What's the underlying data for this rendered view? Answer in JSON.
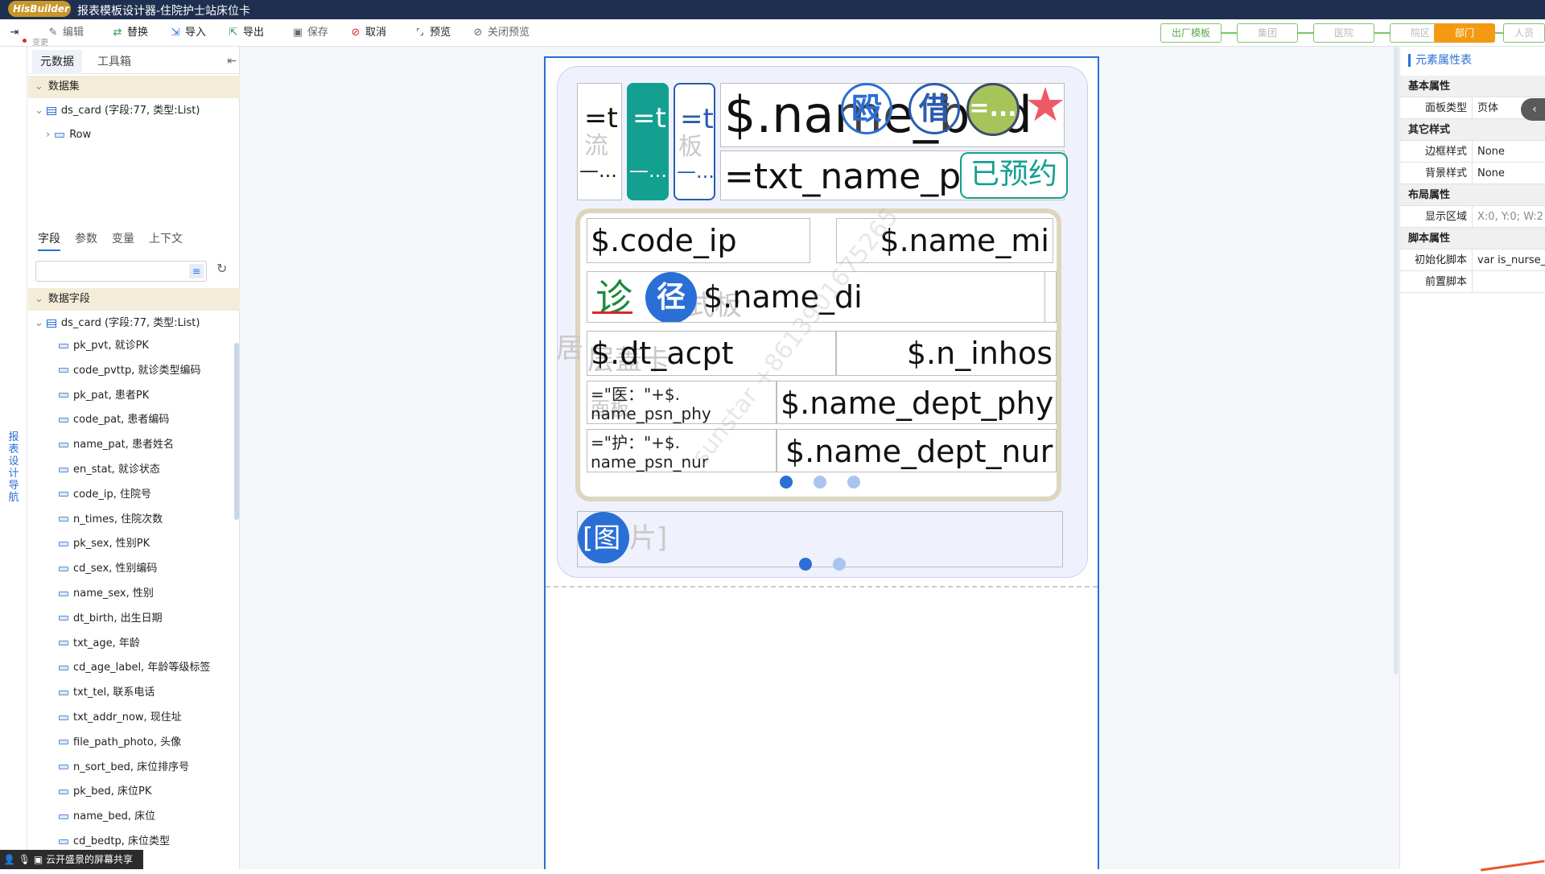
{
  "window": {
    "logo": "HisBuilder",
    "title": "报表模板设计器-住院护士站床位卡"
  },
  "toolbar": {
    "items": [
      {
        "label": "编辑",
        "icon": "pencil-icon"
      },
      {
        "label": "替换",
        "icon": "replace-icon"
      },
      {
        "label": "导入",
        "icon": "import-icon"
      },
      {
        "label": "导出",
        "icon": "export-icon"
      },
      {
        "label": "保存",
        "icon": "save-icon"
      },
      {
        "label": "取消",
        "icon": "cancel-icon"
      },
      {
        "label": "预览",
        "icon": "preview-icon"
      },
      {
        "label": "关闭预览",
        "icon": "close-preview-icon"
      }
    ],
    "sub_label": "变更"
  },
  "workflow": {
    "steps": [
      "出厂模板",
      "集团",
      "医院",
      "院区",
      "部门",
      "人员"
    ],
    "active": "部门"
  },
  "left_nav": {
    "label": "报表设计导航"
  },
  "left_panel": {
    "tabs": [
      "元数据",
      "工具箱"
    ],
    "dataset_header": "数据集",
    "dataset_node": "ds_card (字段:77, 类型:List)",
    "dataset_child": "Row",
    "sub_tabs": [
      "字段",
      "参数",
      "变量",
      "上下文"
    ],
    "search_placeholder": "",
    "fields_header": "数据字段",
    "fields_node": "ds_card (字段:77, 类型:List)",
    "fields": [
      "pk_pvt, 就诊PK",
      "code_pvttp, 就诊类型编码",
      "pk_pat, 患者PK",
      "code_pat, 患者编码",
      "name_pat, 患者姓名",
      "en_stat, 就诊状态",
      "code_ip, 住院号",
      "n_times, 住院次数",
      "pk_sex, 性别PK",
      "cd_sex, 性别编码",
      "name_sex, 性别",
      "dt_birth, 出生日期",
      "txt_age, 年龄",
      "cd_age_label, 年龄等级标签",
      "txt_tel, 联系电话",
      "txt_addr_now, 现住址",
      "file_path_photo, 头像",
      "n_sort_bed, 床位排序号",
      "pk_bed, 床位PK",
      "name_bed, 床位",
      "cd_bedtp, 床位类型"
    ]
  },
  "card": {
    "top_cells": [
      {
        "text": "=t",
        "ghost": "流",
        "sub": "—..."
      },
      {
        "text": "=t",
        "ghost": "",
        "sub": "—..."
      },
      {
        "text": "=t",
        "ghost": "板",
        "sub": "—..."
      }
    ],
    "name_bed": "$.name_bed",
    "badge_a": "殴",
    "badge_b": "借",
    "badge_c": "=...",
    "txt_name": "=txt_name_p",
    "reserved_badge": "已预约",
    "code_ip": "$.code_ip",
    "name_mi": "$.name_mi",
    "diag_icon_label": "诊",
    "path_badge": "径",
    "name_di": "$.name_di",
    "ghost_mid": "式板",
    "ghost_side": "居",
    "ghost_row3": "层蓋卡",
    "dt_acpt": "$.dt_acpt",
    "n_inhos": "$.n_inhos",
    "psn_phy_label": "=\"医：\"+$.",
    "psn_phy_field": "name_psn_phy",
    "dept_phy": "$.name_dept_phy",
    "psn_nur_label": "=\"护：\"+$.",
    "psn_nur_field": "name_psn_nur",
    "dept_nur": "$.name_dept_nur",
    "ghost_small": "面板",
    "image_label": "[图",
    "image_ghost": "片]",
    "watermark": "sunstar +8613901675265"
  },
  "right_panel": {
    "title": "元素属性表",
    "sections": [
      {
        "name": "基本属性",
        "rows": [
          {
            "key": "面板类型",
            "value": "页体"
          }
        ]
      },
      {
        "name": "其它样式",
        "rows": [
          {
            "key": "边框样式",
            "value": "None"
          },
          {
            "key": "背景样式",
            "value": "None"
          }
        ]
      },
      {
        "name": "布局属性",
        "rows": [
          {
            "key": "显示区域",
            "value": "X:0, Y:0; W:2"
          }
        ]
      },
      {
        "name": "脚本属性",
        "rows": [
          {
            "key": "初始化脚本",
            "value": "var is_nurse_"
          },
          {
            "key": "前置脚本",
            "value": ""
          }
        ]
      }
    ]
  },
  "share_bar": {
    "label": "云开盛景的屏幕共享"
  },
  "colors": {
    "title_bar": "#1f2f4f",
    "accent": "#2a6fd6",
    "teal": "#13a090",
    "active_step": "#f39a12",
    "flow_green": "#7cc46a"
  }
}
